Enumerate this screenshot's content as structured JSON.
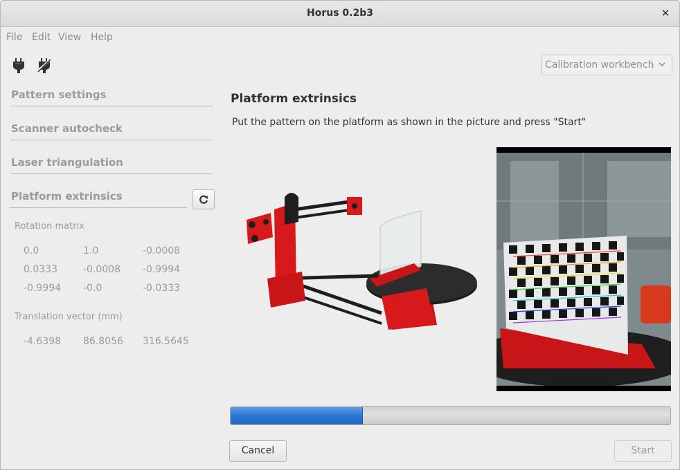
{
  "window": {
    "title": "Horus 0.2b3",
    "close_glyph": "✕"
  },
  "menu": [
    "File",
    "Edit",
    "View",
    "Help"
  ],
  "toolbar": {
    "connect_icon": "plug-connect-icon",
    "disconnect_icon": "plug-disconnect-icon"
  },
  "workbench": {
    "selected": "Calibration workbench"
  },
  "sidebar": {
    "panels": [
      "Pattern settings",
      "Scanner autocheck",
      "Laser triangulation",
      "Platform extrinsics"
    ],
    "rotation_label": "Rotation matrix",
    "rotation_matrix": [
      [
        "0.0",
        "1.0",
        "-0.0008"
      ],
      [
        "0.0333",
        "-0.0008",
        "-0.9994"
      ],
      [
        "-0.9994",
        "-0.0",
        "-0.0333"
      ]
    ],
    "translation_label": "Translation vector (mm)",
    "translation_vector": [
      "-4.6398",
      "86.8056",
      "316.5645"
    ]
  },
  "main": {
    "title": "Platform extrinsics",
    "description": "Put the pattern on the platform as shown in the picture and press \"Start\"",
    "progress": 0.3
  },
  "buttons": {
    "cancel": "Cancel",
    "start": "Start"
  },
  "colors": {
    "accent": "#2a76d2",
    "scanner_red": "#d8191c"
  }
}
